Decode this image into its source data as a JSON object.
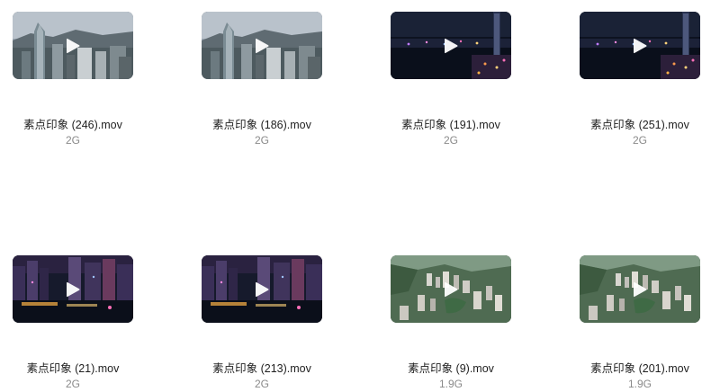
{
  "files": [
    {
      "name": "素点印象 (246).mov",
      "size": "2G",
      "thumb": "day-skyline",
      "icon": "play-icon"
    },
    {
      "name": "素点印象 (186).mov",
      "size": "2G",
      "thumb": "day-skyline",
      "icon": "play-icon"
    },
    {
      "name": "素点印象 (191).mov",
      "size": "2G",
      "thumb": "night-harbor",
      "icon": "play-icon"
    },
    {
      "name": "素点印象 (251).mov",
      "size": "2G",
      "thumb": "night-harbor",
      "icon": "play-icon"
    },
    {
      "name": "素点印象 (21).mov",
      "size": "2G",
      "thumb": "night-city",
      "icon": "play-icon"
    },
    {
      "name": "素点印象 (213).mov",
      "size": "2G",
      "thumb": "night-city",
      "icon": "play-icon"
    },
    {
      "name": "素点印象 (9).mov",
      "size": "1.9G",
      "thumb": "aerial-green",
      "icon": "play-icon"
    },
    {
      "name": "素点印象 (201).mov",
      "size": "1.9G",
      "thumb": "aerial-green",
      "icon": "play-icon"
    }
  ],
  "colors": {
    "name_text": "#1f1f1f",
    "size_text": "#8a8a8a",
    "play_icon": "#ffffff"
  }
}
